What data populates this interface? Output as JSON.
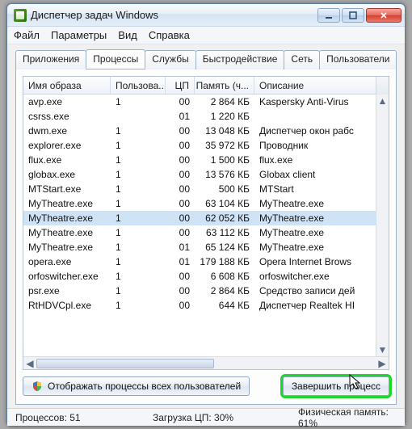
{
  "window": {
    "title": "Диспетчер задач Windows"
  },
  "menu": {
    "file": "Файл",
    "options": "Параметры",
    "view": "Вид",
    "help": "Справка"
  },
  "tabs": {
    "apps": "Приложения",
    "processes": "Процессы",
    "services": "Службы",
    "perf": "Быстродействие",
    "net": "Сеть",
    "users": "Пользователи"
  },
  "columns": {
    "image": "Имя образа",
    "user": "Пользова...",
    "cpu": "ЦП",
    "mem": "Память (ч...",
    "desc": "Описание"
  },
  "rows": [
    {
      "img": "avp.exe",
      "user": "1",
      "cpu": "00",
      "mem": "2 864 КБ",
      "desc": "Kaspersky Anti-Virus"
    },
    {
      "img": "csrss.exe",
      "user": "",
      "cpu": "01",
      "mem": "1 220 КБ",
      "desc": ""
    },
    {
      "img": "dwm.exe",
      "user": "1",
      "cpu": "00",
      "mem": "13 048 КБ",
      "desc": "Диспетчер окон рабс"
    },
    {
      "img": "explorer.exe",
      "user": "1",
      "cpu": "00",
      "mem": "35 972 КБ",
      "desc": "Проводник"
    },
    {
      "img": "flux.exe",
      "user": "1",
      "cpu": "00",
      "mem": "1 500 КБ",
      "desc": "flux.exe"
    },
    {
      "img": "globax.exe",
      "user": "1",
      "cpu": "00",
      "mem": "13 576 КБ",
      "desc": "Globax client"
    },
    {
      "img": "MTStart.exe",
      "user": "1",
      "cpu": "00",
      "mem": "500 КБ",
      "desc": "MTStart"
    },
    {
      "img": "MyTheatre.exe",
      "user": "1",
      "cpu": "00",
      "mem": "63 104 КБ",
      "desc": "MyTheatre.exe"
    },
    {
      "img": "MyTheatre.exe",
      "user": "1",
      "cpu": "00",
      "mem": "62 052 КБ",
      "desc": "MyTheatre.exe",
      "selected": true
    },
    {
      "img": "MyTheatre.exe",
      "user": "1",
      "cpu": "00",
      "mem": "63 112 КБ",
      "desc": "MyTheatre.exe"
    },
    {
      "img": "MyTheatre.exe",
      "user": "1",
      "cpu": "01",
      "mem": "65 124 КБ",
      "desc": "MyTheatre.exe"
    },
    {
      "img": "opera.exe",
      "user": "1",
      "cpu": "01",
      "mem": "179 188 КБ",
      "desc": "Opera Internet Brows"
    },
    {
      "img": "orfoswitcher.exe",
      "user": "1",
      "cpu": "00",
      "mem": "6 608 КБ",
      "desc": "orfoswitcher.exe"
    },
    {
      "img": "psr.exe",
      "user": "1",
      "cpu": "00",
      "mem": "2 864 КБ",
      "desc": "Средство записи дей"
    },
    {
      "img": "RtHDVCpl.exe",
      "user": "1",
      "cpu": "00",
      "mem": "644 КБ",
      "desc": "Диспетчер Realtek HI"
    }
  ],
  "buttons": {
    "show_all": "Отображать процессы всех пользователей",
    "end": "Завершить процесс"
  },
  "status": {
    "processes": "Процессов: 51",
    "cpu": "Загрузка ЦП: 30%",
    "mem": "Физическая память: 61%"
  }
}
